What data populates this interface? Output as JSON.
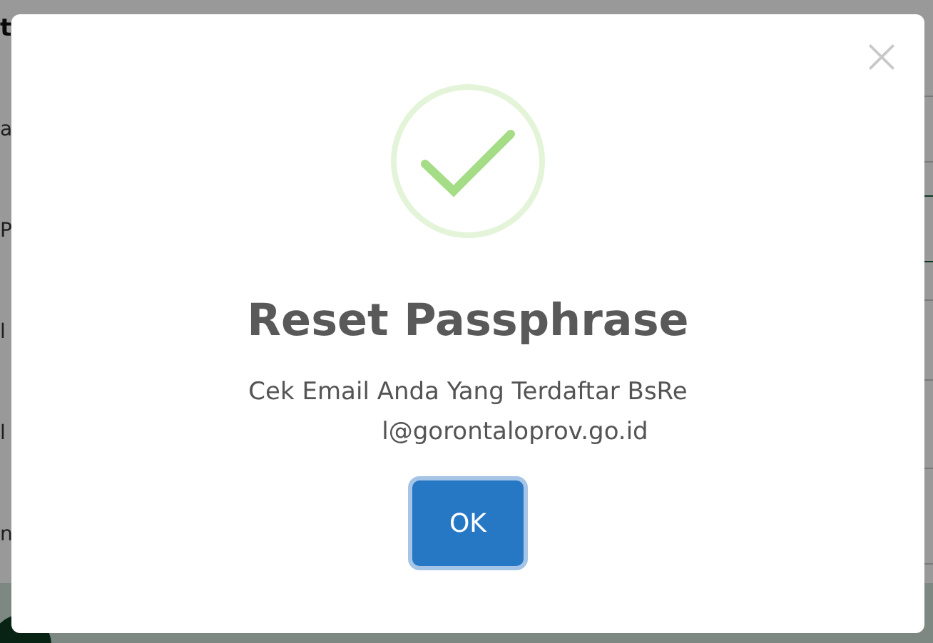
{
  "background_page": {
    "fragments": [
      "t",
      "a",
      "P",
      "l",
      "l",
      "n"
    ]
  },
  "dialog": {
    "title": "Reset Passphrase",
    "message": "Cek Email Anda Yang Terdaftar BsRe",
    "email": "l@gorontaloprov.go.id",
    "confirm_button": "OK",
    "icon": {
      "kind": "success"
    }
  }
}
